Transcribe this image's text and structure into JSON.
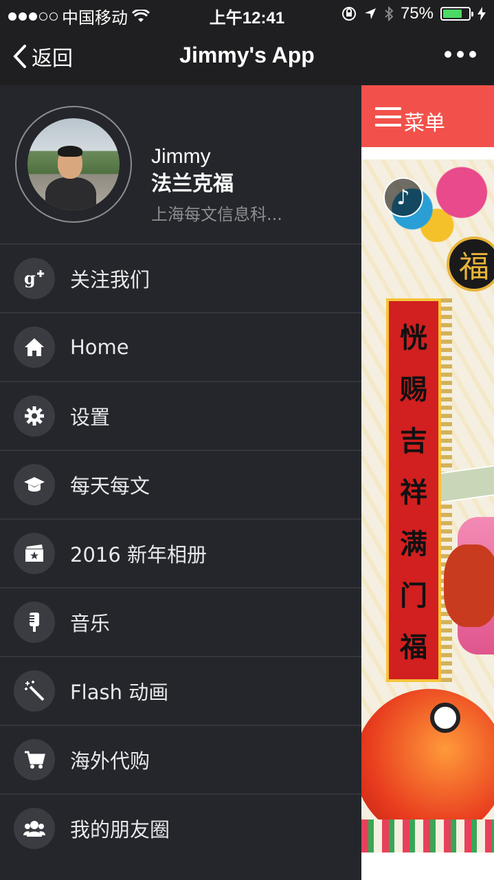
{
  "status_bar": {
    "carrier": "中国移动",
    "time": "上午12:41",
    "battery_percent": "75%",
    "battery_level": 0.75,
    "signal_filled": 3,
    "signal_total": 5
  },
  "navbar": {
    "back_label": "返回",
    "title": "Jimmy's App"
  },
  "profile": {
    "name": "Jimmy",
    "city": "法兰克福",
    "company": "上海每文信息科..."
  },
  "menu": {
    "items": [
      {
        "label": "关注我们",
        "icon": "google-plus-icon"
      },
      {
        "label": "Home",
        "icon": "home-icon"
      },
      {
        "label": "设置",
        "icon": "gear-icon"
      },
      {
        "label": "每天每文",
        "icon": "graduation-cap-icon"
      },
      {
        "label": "2016 新年相册",
        "icon": "ticket-star-icon"
      },
      {
        "label": "音乐",
        "icon": "microphone-icon"
      },
      {
        "label": "Flash 动画",
        "icon": "magic-wand-icon"
      },
      {
        "label": "海外代购",
        "icon": "cart-icon"
      },
      {
        "label": "我的朋友圈",
        "icon": "users-icon"
      }
    ]
  },
  "content": {
    "menu_button_label": "菜单",
    "couplet_chars": [
      "恍",
      "赐",
      "吉",
      "祥",
      "满",
      "门",
      "福"
    ],
    "fu_char": "福"
  },
  "colors": {
    "accent": "#f2514b",
    "sidebar_bg": "#24262b",
    "navbar_bg": "#1f1f21",
    "battery": "#4cd964"
  }
}
